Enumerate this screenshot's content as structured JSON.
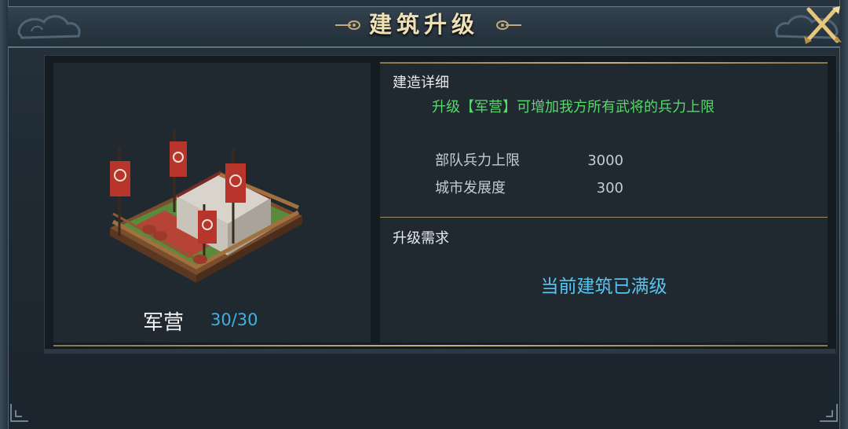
{
  "window": {
    "title": "建筑升级",
    "close_icon": "crossed-swords-close-icon"
  },
  "building": {
    "name": "军营",
    "level": "30/30",
    "image": "barracks-tent-icon"
  },
  "detail": {
    "section_title": "建造详细",
    "description": "升级【军营】可增加我方所有武将的兵力上限",
    "stats": [
      {
        "name": "部队兵力上限",
        "value": "3000"
      },
      {
        "name": "城市发展度",
        "value": "300"
      }
    ]
  },
  "requirements": {
    "section_title": "升级需求",
    "status": "当前建筑已满级"
  },
  "colors": {
    "description_green": "#58d86b",
    "level_blue": "#3fb1e4",
    "status_blue": "#56c5ef",
    "title_gold": "#efe1b6",
    "divider_gold": "#c6b184"
  }
}
